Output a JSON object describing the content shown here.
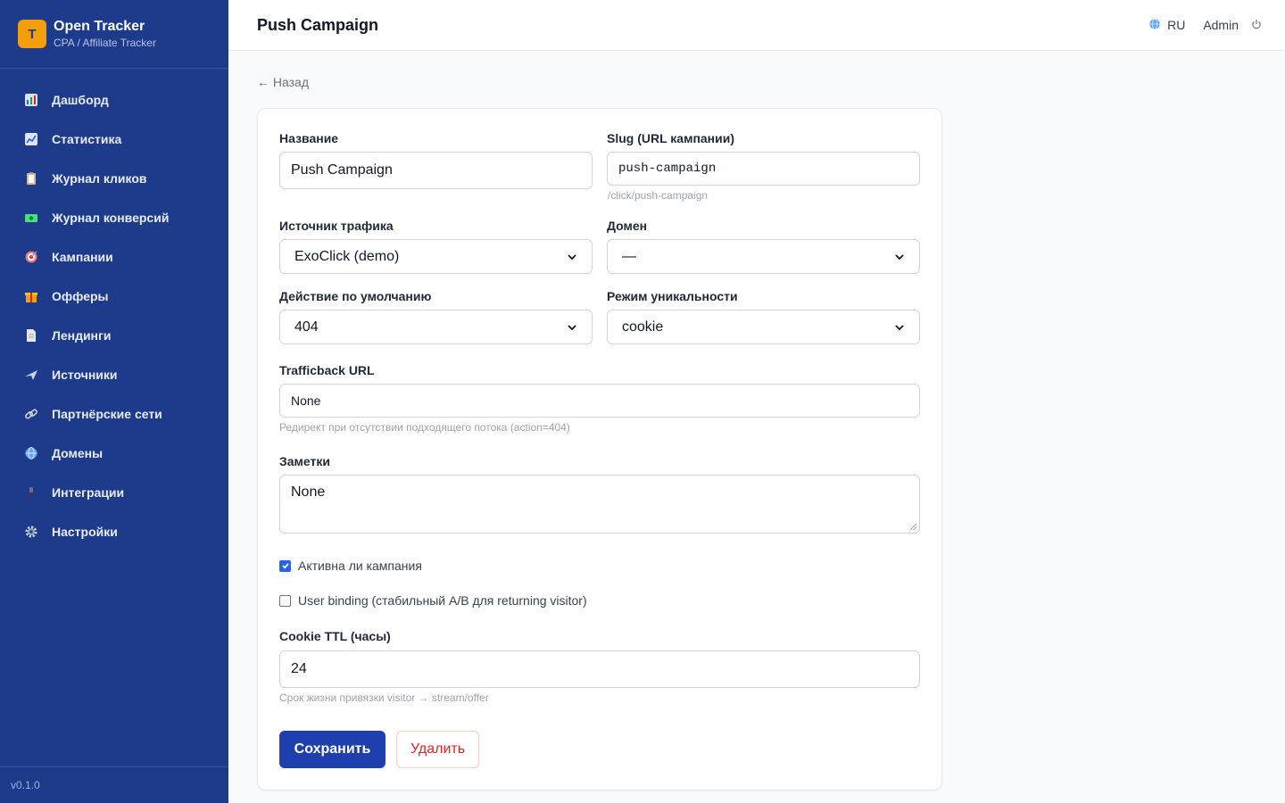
{
  "app": {
    "name": "Open Tracker",
    "subtitle": "CPA / Affiliate Tracker",
    "logo_letter": "T",
    "version": "v0.1.0"
  },
  "colors": {
    "sidebar": "#1e3a8a",
    "accent": "#1e40af",
    "logo": "#f59e0b",
    "danger": "#dc2626"
  },
  "sidebar": {
    "items": [
      {
        "label": "Дашборд",
        "icon": "bar-chart-icon"
      },
      {
        "label": "Статистика",
        "icon": "line-chart-icon"
      },
      {
        "label": "Журнал кликов",
        "icon": "clipboard-icon"
      },
      {
        "label": "Журнал конверсий",
        "icon": "money-icon"
      },
      {
        "label": "Кампании",
        "icon": "target-icon"
      },
      {
        "label": "Офферы",
        "icon": "gift-icon"
      },
      {
        "label": "Лендинги",
        "icon": "page-icon"
      },
      {
        "label": "Источники",
        "icon": "airplane-icon"
      },
      {
        "label": "Партнёрские сети",
        "icon": "link-icon"
      },
      {
        "label": "Домены",
        "icon": "globe-icon"
      },
      {
        "label": "Интеграции",
        "icon": "plug-icon"
      },
      {
        "label": "Настройки",
        "icon": "gear-icon"
      }
    ]
  },
  "header": {
    "title": "Push Campaign",
    "lang": "RU",
    "user": "Admin"
  },
  "back_label": "← Назад",
  "form": {
    "name": {
      "label": "Название",
      "value": "Push Campaign"
    },
    "slug": {
      "label": "Slug (URL кампании)",
      "value": "push-campaign",
      "hint": "/click/push-campaign"
    },
    "source": {
      "label": "Источник трафика",
      "value": "ExoClick (demo)"
    },
    "domain": {
      "label": "Домен",
      "value": "—"
    },
    "default_action": {
      "label": "Действие по умолчанию",
      "value": "404"
    },
    "uniqueness": {
      "label": "Режим уникальности",
      "value": "cookie"
    },
    "trafficback": {
      "label": "Trafficback URL",
      "value": "None",
      "hint": "Редирект при отсутствии подходящего потока (action=404)"
    },
    "notes": {
      "label": "Заметки",
      "value": "None"
    },
    "active": {
      "label": "Активна ли кампания",
      "checked": true
    },
    "user_binding": {
      "label": "User binding (стабильный A/B для returning visitor)",
      "checked": false
    },
    "cookie_ttl": {
      "label": "Cookie TTL (часы)",
      "value": "24",
      "hint": "Срок жизни привязки visitor → stream/offer"
    },
    "save_label": "Сохранить",
    "delete_label": "Удалить"
  }
}
